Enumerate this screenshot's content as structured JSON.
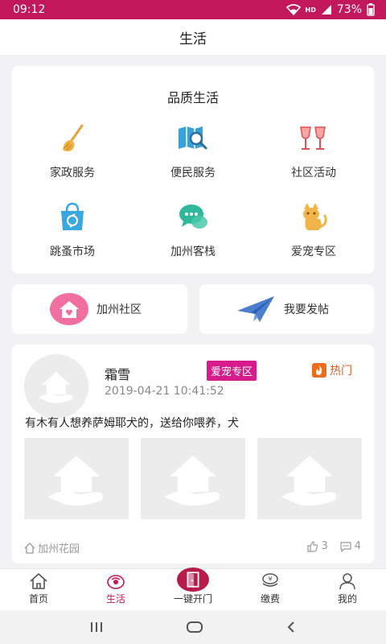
{
  "status_bar": {
    "time": "09:12",
    "network": "HD",
    "battery": "73%"
  },
  "page": {
    "title": "生活"
  },
  "quality": {
    "title": "品质生活",
    "items": [
      {
        "label": "家政服务",
        "icon": "broom-icon"
      },
      {
        "label": "便民服务",
        "icon": "map-search-icon"
      },
      {
        "label": "社区活动",
        "icon": "wine-glasses-icon"
      },
      {
        "label": "跳蚤市场",
        "icon": "shopping-bag-icon"
      },
      {
        "label": "加州客栈",
        "icon": "chat-bubbles-icon"
      },
      {
        "label": "爱宠专区",
        "icon": "cat-icon"
      }
    ]
  },
  "actions": {
    "community": "加州社区",
    "post": "我要发帖"
  },
  "feed": {
    "user_name": "霜雪",
    "tag": "爱宠专区",
    "hot": "热门",
    "time": "2019-04-21 10:41:52",
    "text": "有木有人想养萨姆耶犬的，送给你喂养，犬",
    "location": "加州花园",
    "likes": "3",
    "comments": "4"
  },
  "tabs": [
    {
      "label": "首页"
    },
    {
      "label": "生活"
    },
    {
      "label": "一键开门"
    },
    {
      "label": "缴费"
    },
    {
      "label": "我的"
    }
  ],
  "colors": {
    "accent": "#c2185b",
    "tag": "#d81b8c",
    "hot": "#e55a1c"
  }
}
